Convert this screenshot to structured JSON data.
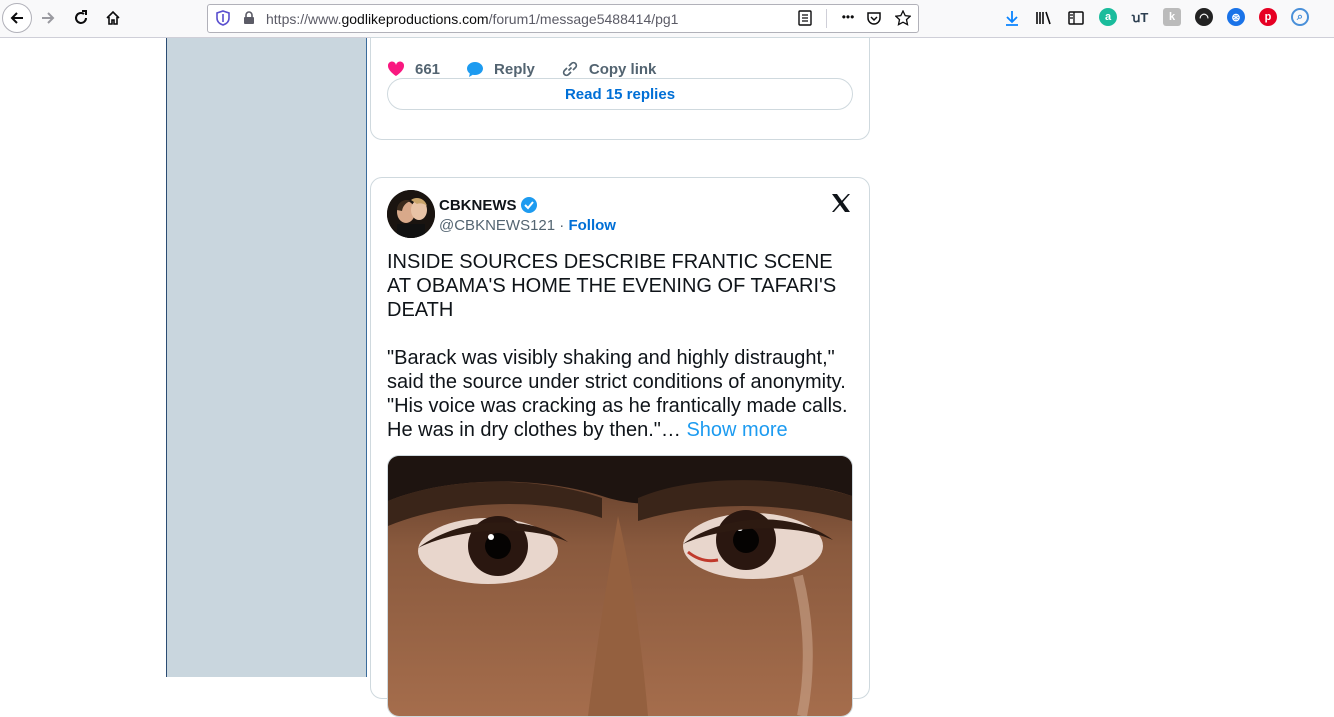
{
  "browser": {
    "url_prefix": "https://www.",
    "url_domain": "godlikeproductions.com",
    "url_path": "/forum1/message5488414/pg1",
    "overflow_label": "•••"
  },
  "prev_tweet": {
    "likes": "661",
    "reply_label": "Reply",
    "copy_label": "Copy link",
    "read_replies_label": "Read 15 replies"
  },
  "tweet": {
    "display_name": "CBKNEWS",
    "handle": "@CBKNEWS121",
    "separator": " · ",
    "follow_label": "Follow",
    "body": "INSIDE SOURCES DESCRIBE FRANTIC SCENE AT OBAMA'S HOME THE EVENING OF TAFARI'S DEATH\n\n\"Barack was visibly shaking and highly distraught,\" said the source under strict conditions of anonymity. \"His voice was cracking as he frantically made calls. He was in dry clothes by then.\"… ",
    "show_more": "Show more"
  },
  "colors": {
    "sidebar": "#c9d6de",
    "link_blue": "#006fd6",
    "heart": "#f91880",
    "twitter_blue": "#1d9bf0"
  }
}
